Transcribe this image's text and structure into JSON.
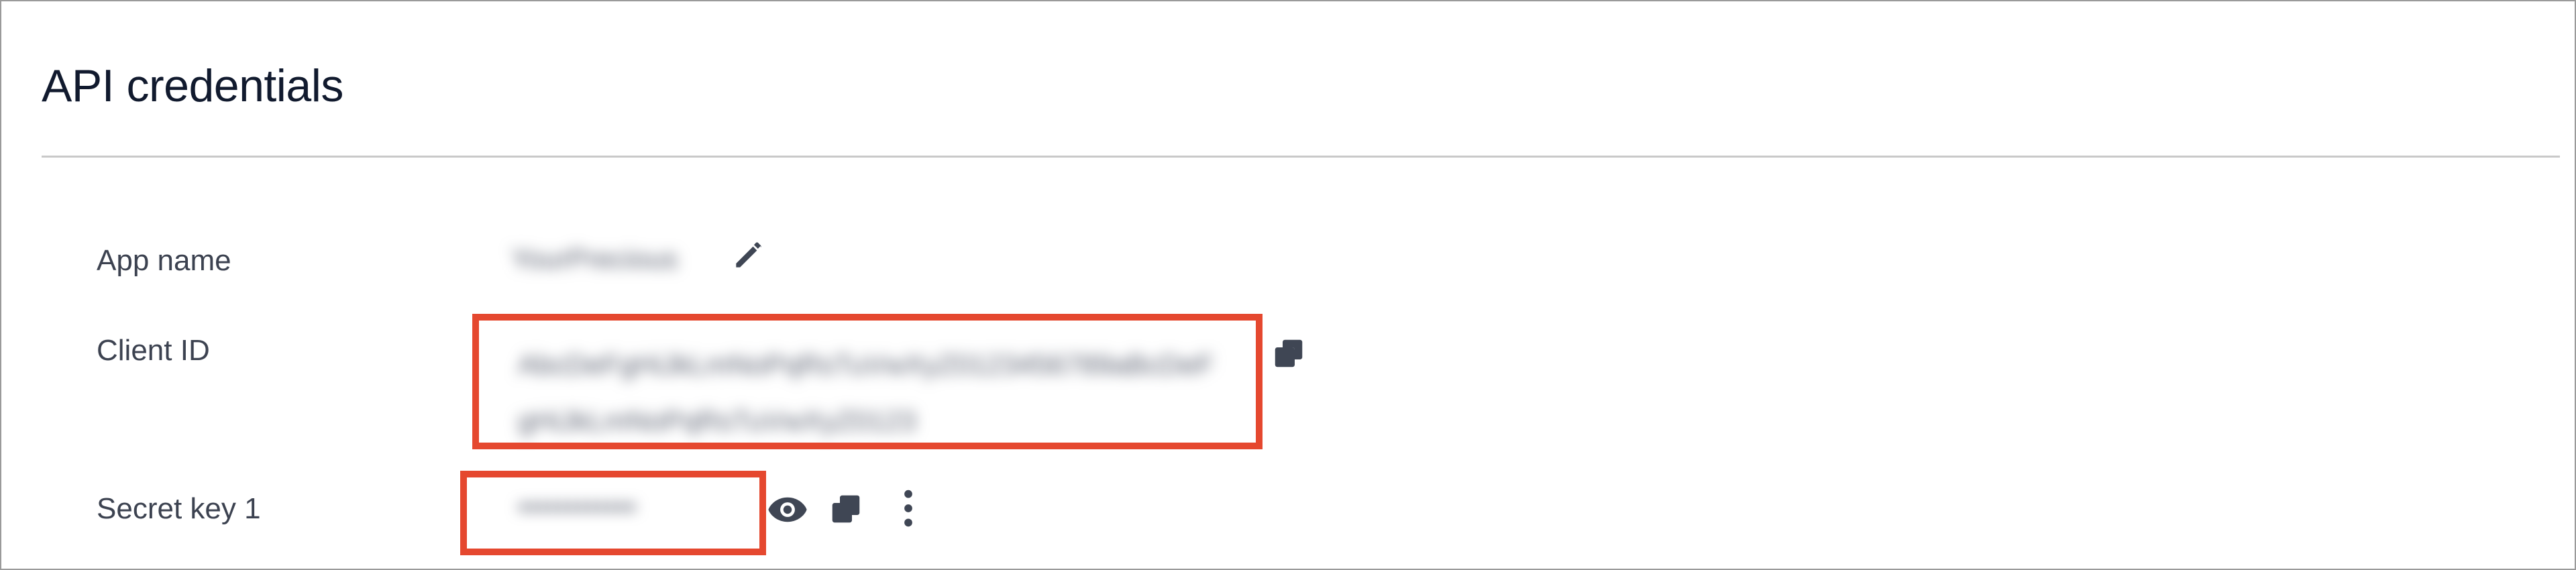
{
  "panel": {
    "title": "API credentials"
  },
  "fields": {
    "app_name": {
      "label": "App name",
      "value": "YourPrecious"
    },
    "client_id": {
      "label": "Client ID",
      "value": "AbcDeFgHiJkLmNoPqRsTuVwXyZ0123456789aBcDeFgHiJkLmNoPqRsTuVwXyZ0123"
    },
    "secret_key_1": {
      "label": "Secret key 1",
      "value": "••••••••••••"
    }
  },
  "icons": {
    "edit": "pencil-icon",
    "copy_client": "copy-icon",
    "reveal": "eye-icon",
    "copy_secret": "copy-icon",
    "more": "more-vertical-icon"
  },
  "colors": {
    "highlight": "#e5482f",
    "icon": "#3f4654",
    "divider": "#c9c9c9"
  }
}
